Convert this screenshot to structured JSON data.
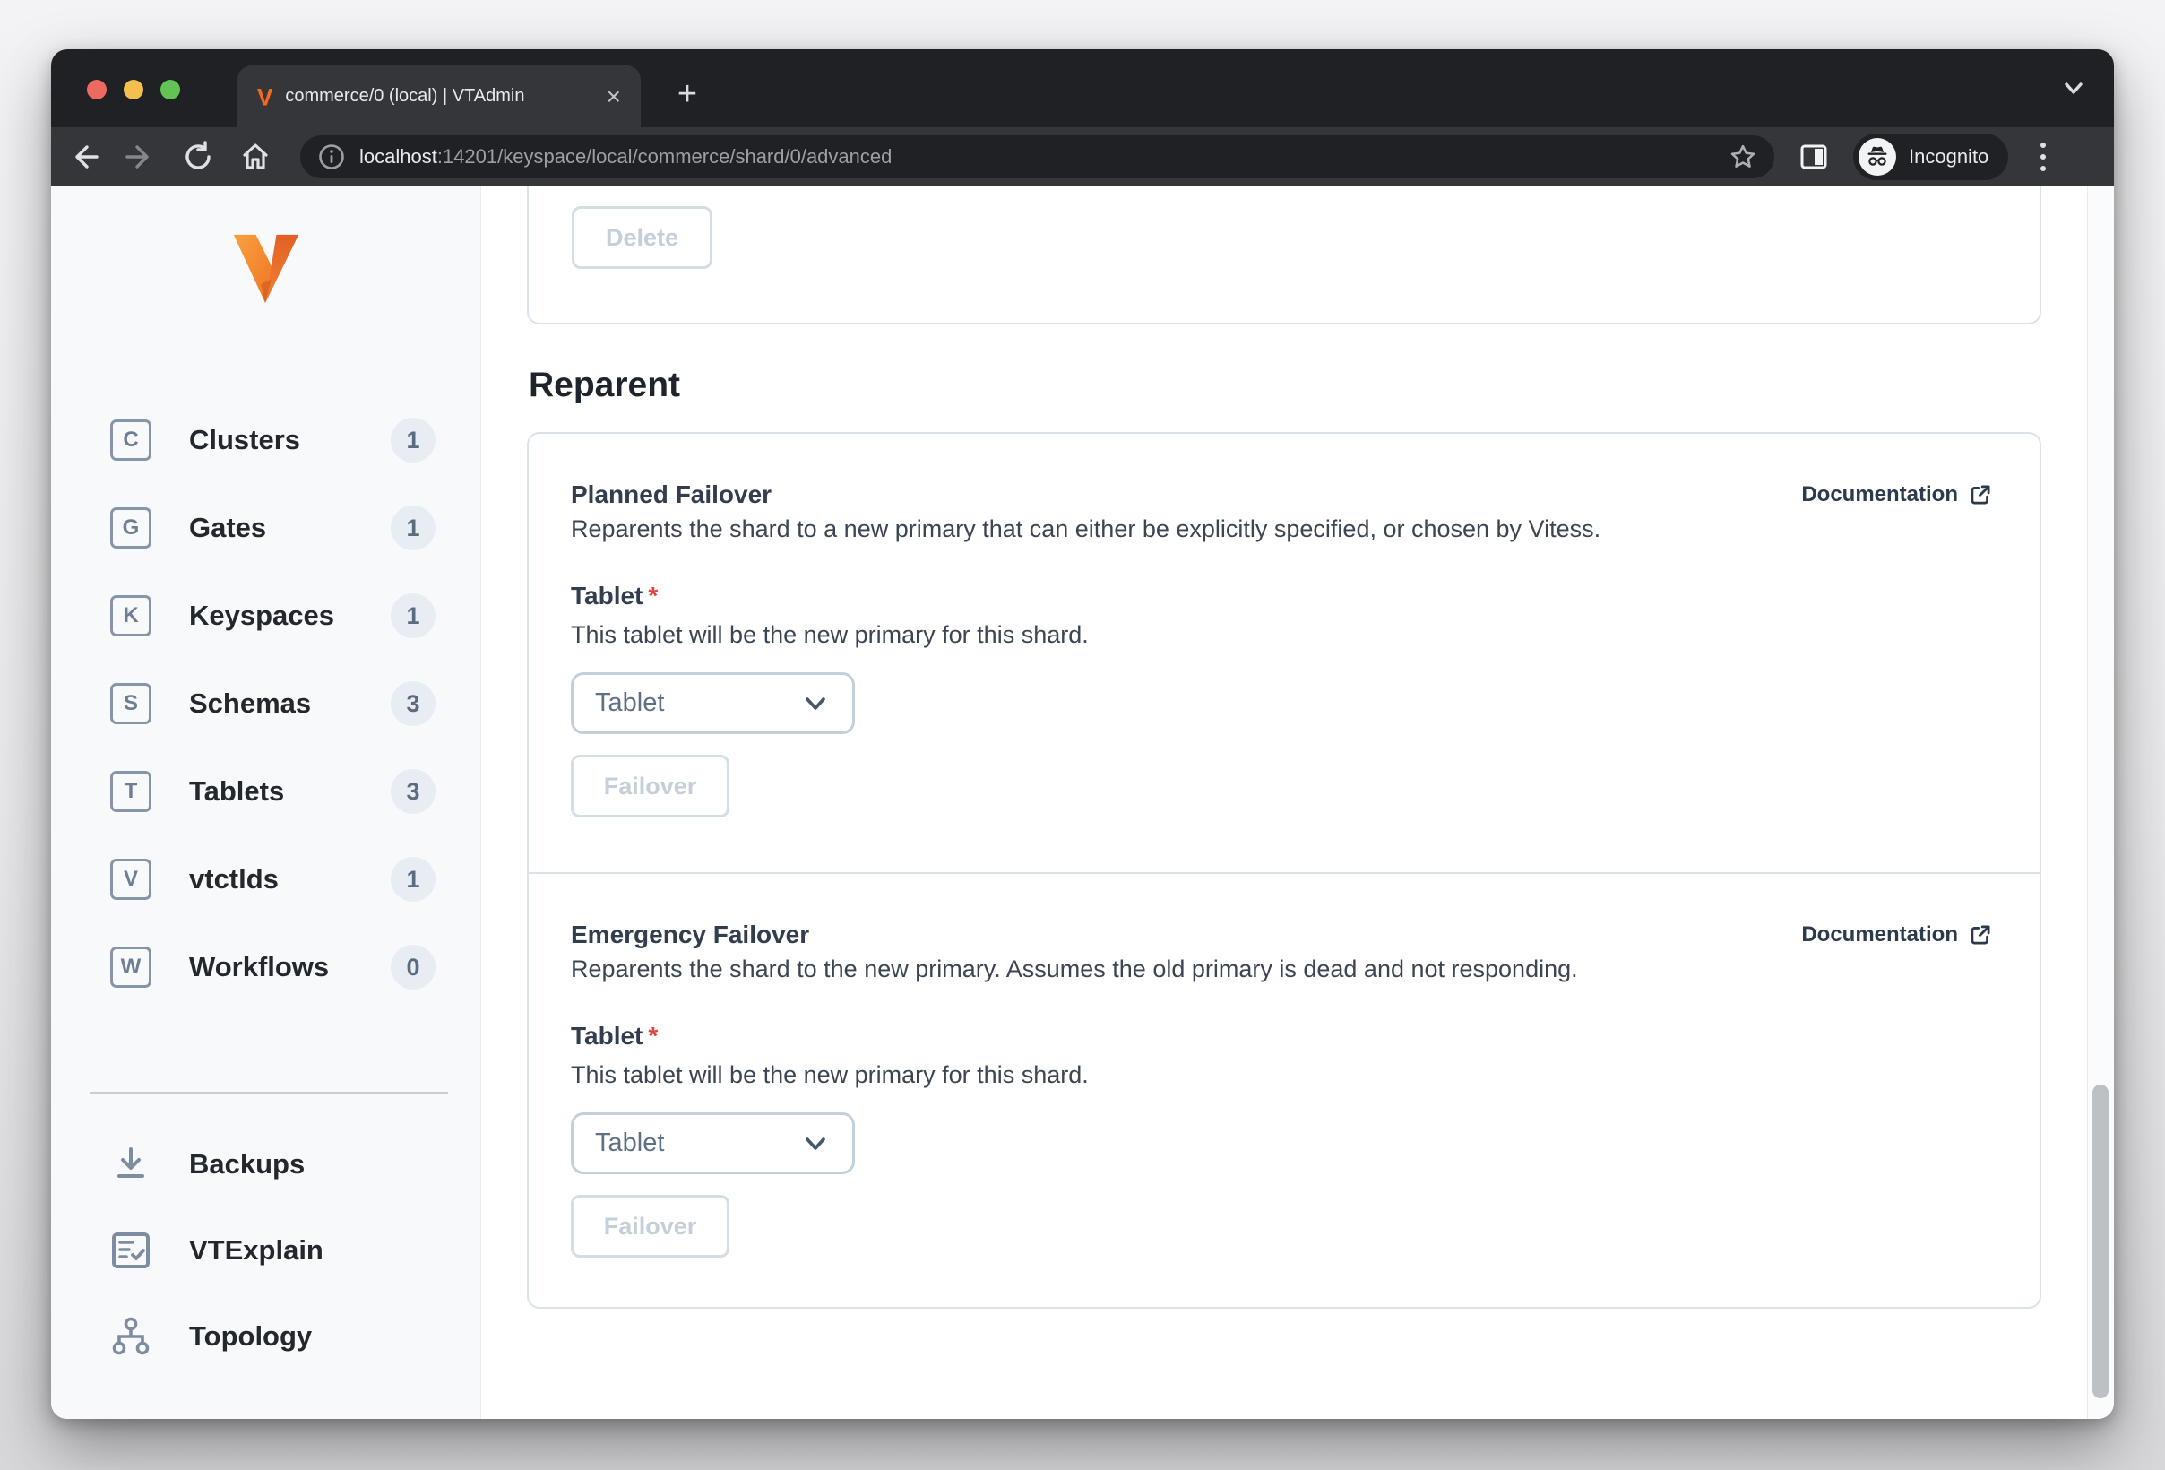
{
  "browser": {
    "tab_title": "commerce/0 (local) | VTAdmin",
    "favicon_letter": "V",
    "close_tab_glyph": "×",
    "new_tab_glyph": "+",
    "url_host": "localhost",
    "url_rest": ":14201/keyspace/local/commerce/shard/0/advanced",
    "incognito_label": "Incognito"
  },
  "sidebar": {
    "items": [
      {
        "letter": "C",
        "label": "Clusters",
        "count": "1"
      },
      {
        "letter": "G",
        "label": "Gates",
        "count": "1"
      },
      {
        "letter": "K",
        "label": "Keyspaces",
        "count": "1"
      },
      {
        "letter": "S",
        "label": "Schemas",
        "count": "3"
      },
      {
        "letter": "T",
        "label": "Tablets",
        "count": "3"
      },
      {
        "letter": "V",
        "label": "vtctlds",
        "count": "1"
      },
      {
        "letter": "W",
        "label": "Workflows",
        "count": "0"
      }
    ],
    "tools": [
      {
        "label": "Backups"
      },
      {
        "label": "VTExplain"
      },
      {
        "label": "Topology"
      }
    ]
  },
  "main": {
    "delete_button_label": "Delete",
    "section_title": "Reparent",
    "cards": [
      {
        "title": "Planned Failover",
        "description": "Reparents the shard to a new primary that can either be explicitly specified, or chosen by Vitess.",
        "doc_label": "Documentation",
        "field_label": "Tablet",
        "required_mark": "*",
        "field_help": "This tablet will be the new primary for this shard.",
        "select_value": "Tablet",
        "button_label": "Failover"
      },
      {
        "title": "Emergency Failover",
        "description": "Reparents the shard to the new primary. Assumes the old primary is dead and not responding.",
        "doc_label": "Documentation",
        "field_label": "Tablet",
        "required_mark": "*",
        "field_help": "This tablet will be the new primary for this shard.",
        "select_value": "Tablet",
        "button_label": "Failover"
      }
    ]
  },
  "colors": {
    "accent_orange": "#f06b21",
    "badge_bg": "#e8edf3",
    "card_border": "#dbe2e9",
    "disabled_text": "#c4cfda",
    "required_red": "#e0443e",
    "chrome_dark": "#202124",
    "chrome_mid": "#35363a"
  }
}
